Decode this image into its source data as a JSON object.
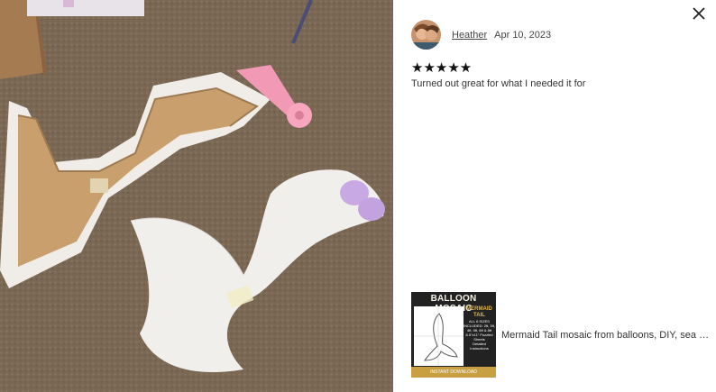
{
  "review": {
    "reviewer_name": "Heather",
    "date": "Apr 10, 2023",
    "rating": 5,
    "stars": "★★★★★",
    "text": "Turned out great for what I needed it for"
  },
  "product": {
    "title": "Mermaid Tail mosaic from balloons, DIY, sea the...",
    "thumbnail": {
      "title": "BALLOON MOSAIC",
      "subtitle": "MERMAID TAIL",
      "sizes_note": "ALL 6 SIZES INCLUDED: 2ft, 3ft, 4ft, 5ft, 6ft & 8ft",
      "sheets_note": "8.5\"x11\" Puzzled Sheets",
      "instructions_note": "Detailed Instructions",
      "footer": "INSTANT DOWNLOAD"
    }
  },
  "icons": {
    "close": "close-icon",
    "avatar": "avatar"
  },
  "colors": {
    "carpet": "#7b6a58",
    "cardboard": "#c99f6d",
    "white_board": "#f1efec",
    "pink_ribbon": "#f29ab5",
    "lavender": "#c9a9e3",
    "gold": "#c8a041"
  }
}
